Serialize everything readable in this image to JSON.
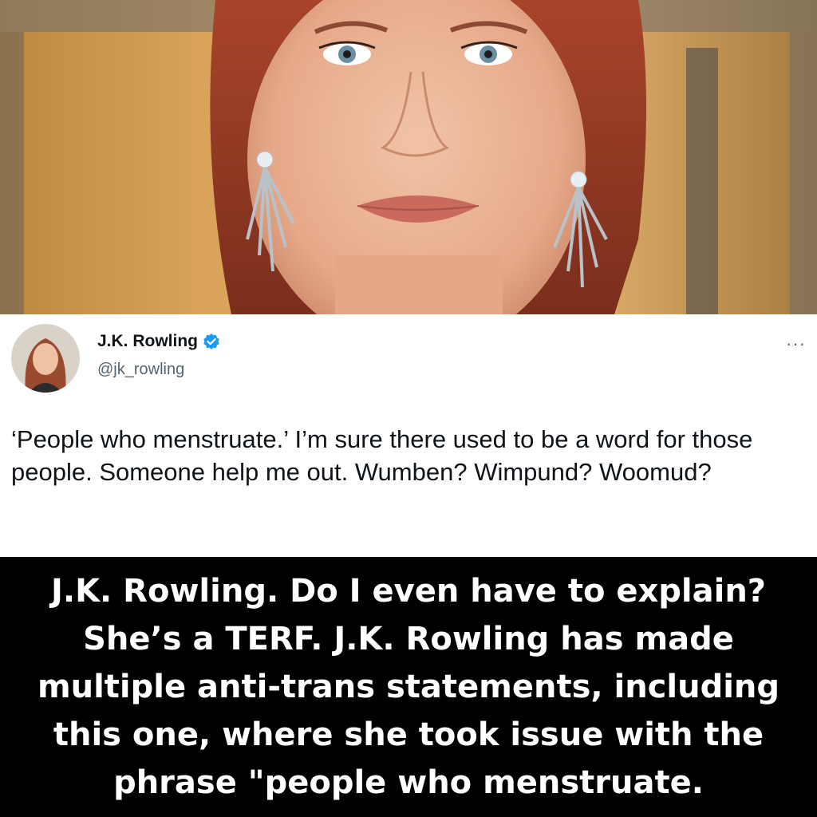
{
  "tweet": {
    "display_name": "J.K. Rowling",
    "handle": "@jk_rowling",
    "more_glyph": "···",
    "verified_icon": "verified-badge-icon",
    "text": "‘People who menstruate.’ I’m sure there used to be a word for those people. Someone help me out. Wumben? Wimpund? Woomud?"
  },
  "caption": {
    "text": "J.K. Rowling. Do I even have to explain? She’s a TERF. J.K. Rowling has made multiple anti-trans statements, including this one, where she took issue with the phrase \"people who menstruate."
  },
  "colors": {
    "verified_blue": "#1d9bf0",
    "handle_gray": "#536471",
    "text_black": "#0f1419",
    "caption_bg": "#000000",
    "caption_text": "#ffffff"
  }
}
